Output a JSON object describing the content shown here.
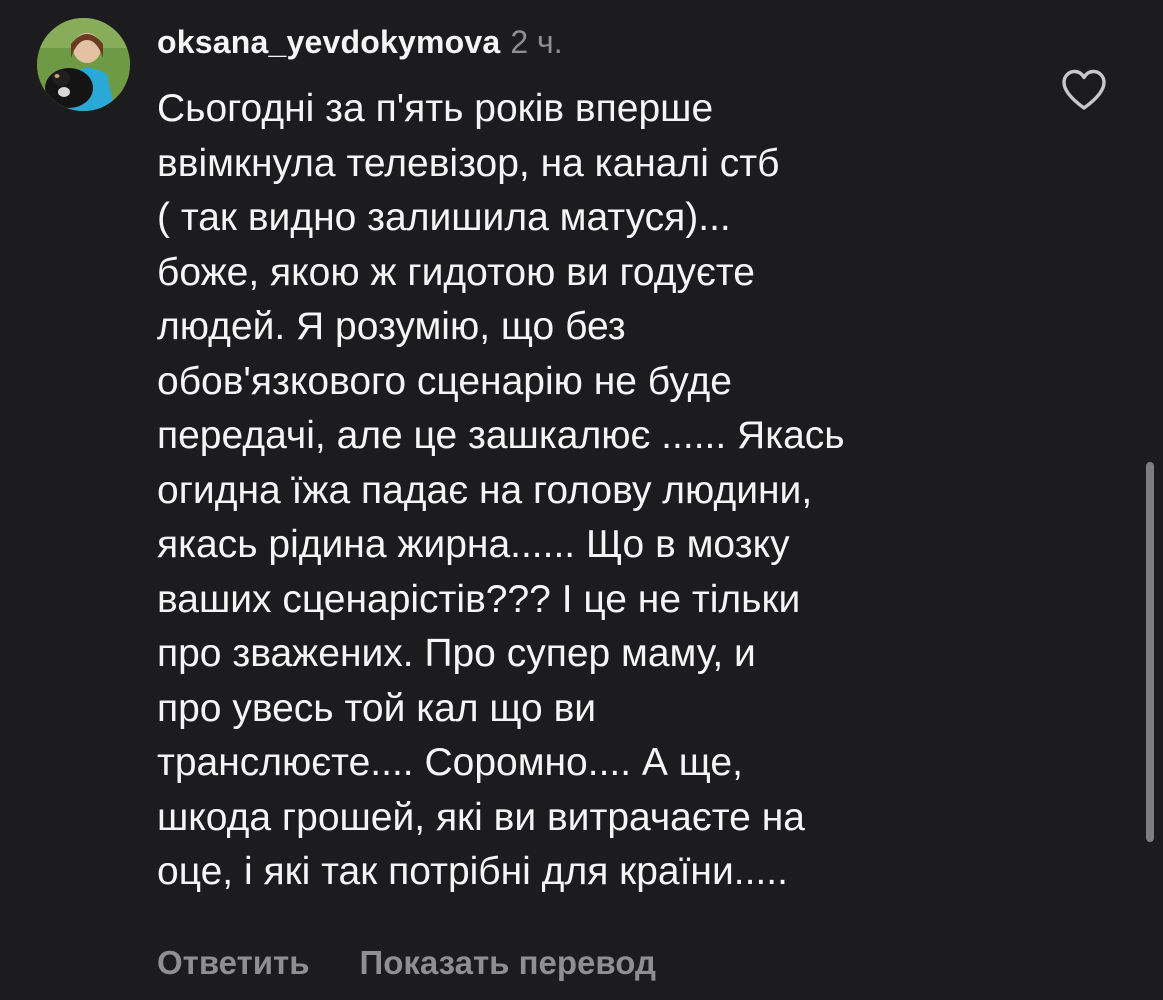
{
  "comment": {
    "username": "oksana_yevdokymova",
    "timestamp": "2 ч.",
    "lines": [
      "Сьогодні за п'ять років вперше",
      "ввімкнула телевізор, на каналі стб",
      "( так видно залишила матуся)...",
      "боже, якою ж гидотою ви годуєте",
      "людей. Я розумію, що без",
      "обов'язкового сценарію не буде",
      "передачі, але це зашкалює ...... Якась",
      "огидна їжа падає на голову людини,",
      "якась рідина жирна...... Що в мозку",
      "ваших сценарістів??? І це не тільки",
      "про зважених. Про супер маму, и",
      "про увесь той кал що ви",
      "транслюєте.... Соромно.... А ще,",
      "шкода грошей, які ви витрачаєте на",
      "оце, і які так потрібні для країни....."
    ]
  },
  "actions": {
    "reply_label": "Ответить",
    "translate_label": "Показать перевод"
  },
  "icons": {
    "like": "heart-outline-icon",
    "avatar": "user-avatar"
  },
  "colors": {
    "background": "#1c1c1e",
    "text": "#f5f5f5",
    "secondary": "#8e8e93"
  }
}
